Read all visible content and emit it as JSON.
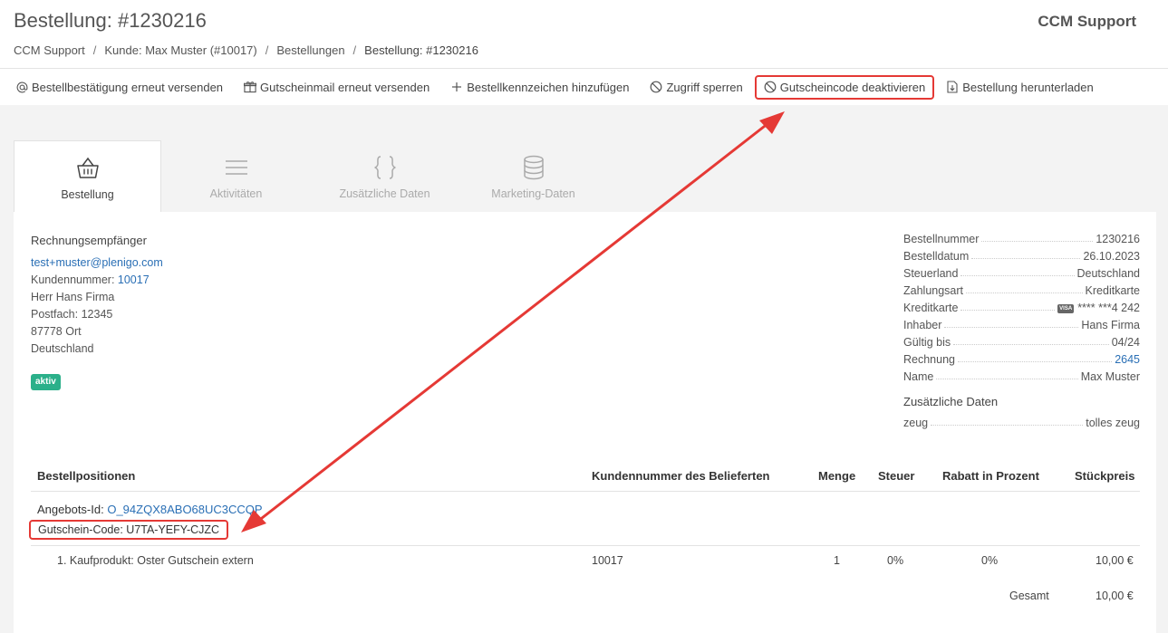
{
  "header": {
    "title": "Bestellung: #1230216",
    "brand": "CCM Support",
    "breadcrumb": [
      "CCM Support",
      "Kunde: Max Muster (#10017)",
      "Bestellungen",
      "Bestellung: #1230216"
    ]
  },
  "toolbar": {
    "resend_confirmation": "Bestellbestätigung erneut versenden",
    "resend_voucher_mail": "Gutscheinmail erneut versenden",
    "add_order_tag": "Bestellkennzeichen hinzufügen",
    "block_access": "Zugriff sperren",
    "deactivate_voucher": "Gutscheincode deaktivieren",
    "download_order": "Bestellung herunterladen"
  },
  "tabs": [
    "Bestellung",
    "Aktivitäten",
    "Zusätzliche Daten",
    "Marketing-Daten"
  ],
  "recipient": {
    "heading": "Rechnungsempfänger",
    "email": "test+muster@plenigo.com",
    "customer_number_label": "Kundennummer:",
    "customer_number": "10017",
    "name": "Herr Hans Firma",
    "po_box": "Postfach: 12345",
    "city": "87778 Ort",
    "country": "Deutschland",
    "status": "aktiv"
  },
  "details": {
    "rows": [
      {
        "key": "Bestellnummer",
        "value": "1230216"
      },
      {
        "key": "Bestelldatum",
        "value": "26.10.2023"
      },
      {
        "key": "Steuerland",
        "value": "Deutschland"
      },
      {
        "key": "Zahlungsart",
        "value": "Kreditkarte"
      },
      {
        "key": "Kreditkarte",
        "value": "**** ***4 242"
      },
      {
        "key": "Inhaber",
        "value": "Hans Firma"
      },
      {
        "key": "Gültig bis",
        "value": "04/24"
      },
      {
        "key": "Rechnung",
        "value": "2645"
      },
      {
        "key": "Name",
        "value": "Max Muster"
      }
    ],
    "card_brand": "VISA",
    "extra_title": "Zusätzliche Daten",
    "extra_rows": [
      {
        "key": "zeug",
        "value": "tolles zeug"
      }
    ]
  },
  "table": {
    "headers": [
      "Bestellpositionen",
      "Kundennummer des Belieferten",
      "Menge",
      "Steuer",
      "Rabatt in Prozent",
      "Stückpreis"
    ],
    "offer_label": "Angebots-Id:",
    "offer_id": "O_94ZQX8ABO68UC3CCQP",
    "voucher": "Gutschein-Code: U7TA-YEFY-CJZC",
    "rows": [
      {
        "position": "1. Kaufprodukt: Oster Gutschein extern",
        "customer_number": "10017",
        "quantity": "1",
        "tax": "0%",
        "discount": "0%",
        "unit_price": "10,00 €"
      }
    ],
    "total_label": "Gesamt",
    "total_value": "10,00 €"
  },
  "colors": {
    "accent_link": "#2a6fb5",
    "highlight_red": "#e53935",
    "badge_green": "#2bb08a"
  }
}
